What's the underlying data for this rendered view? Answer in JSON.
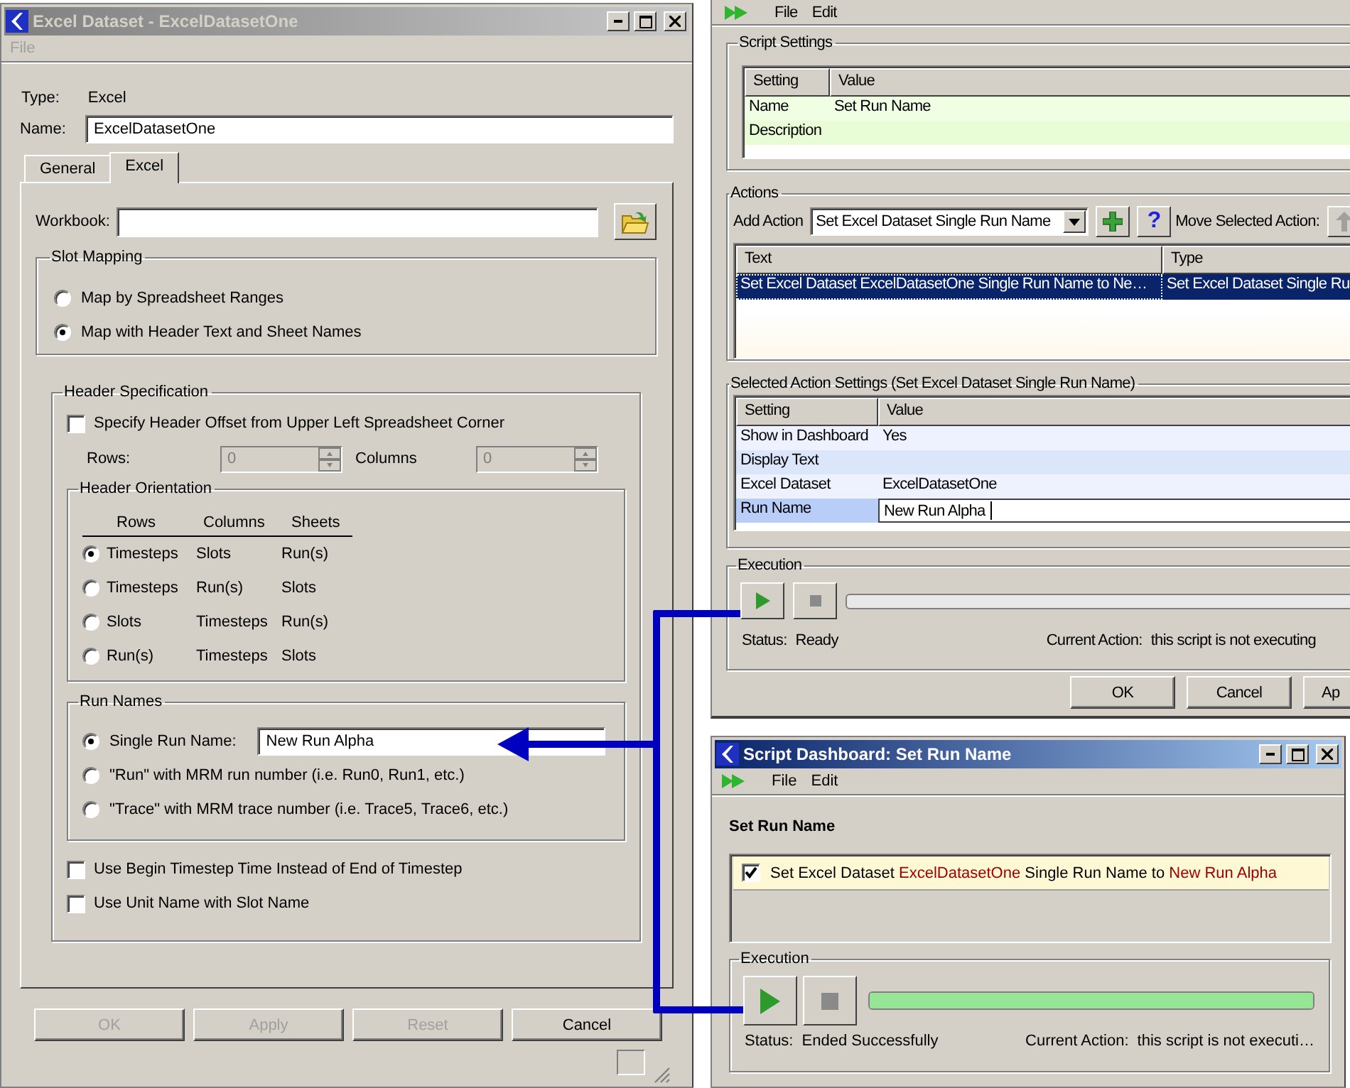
{
  "dataset_window": {
    "title": "Excel Dataset - ExcelDatasetOne",
    "active": false,
    "menu": [
      {
        "label": "File",
        "disabled": true
      }
    ],
    "type_label": "Type:",
    "type_value": "Excel",
    "name_label": "Name:",
    "name_value": "ExcelDatasetOne",
    "tabs": [
      {
        "label": "General",
        "selected": false
      },
      {
        "label": "Excel",
        "selected": true
      }
    ],
    "workbook_label": "Workbook:",
    "slot_mapping": {
      "title": "Slot Mapping",
      "options": [
        {
          "label": "Map by Spreadsheet Ranges",
          "selected": false
        },
        {
          "label": "Map with Header Text and Sheet Names",
          "selected": true
        }
      ]
    },
    "header_specification": {
      "title": "Header Specification",
      "offset": {
        "label": "Specify Header Offset from Upper Left Spreadsheet Corner",
        "checked": false
      },
      "rows_label": "Rows:",
      "rows_value": "0",
      "columns_label": "Columns",
      "columns_value": "0",
      "orientation": {
        "title": "Header Orientation",
        "columns": [
          "Rows",
          "Columns",
          "Sheets"
        ],
        "options": [
          {
            "cells": [
              "Timesteps",
              "Slots",
              "Run(s)"
            ],
            "selected": true
          },
          {
            "cells": [
              "Timesteps",
              "Run(s)",
              "Slots"
            ],
            "selected": false
          },
          {
            "cells": [
              "Slots",
              "Timesteps",
              "Run(s)"
            ],
            "selected": false
          },
          {
            "cells": [
              "Run(s)",
              "Timesteps",
              "Slots"
            ],
            "selected": false
          }
        ]
      },
      "run_names": {
        "title": "Run Names",
        "options": [
          {
            "label": "Single Run Name:",
            "value": "New Run Alpha",
            "selected": true
          },
          {
            "label": "\"Run\" with MRM run number (i.e. Run0, Run1, etc.)",
            "selected": false
          },
          {
            "label": "\"Trace\" with MRM trace number (i.e. Trace5, Trace6, etc.)",
            "selected": false
          }
        ]
      },
      "options": [
        {
          "label": "Use Begin Timestep Time Instead of End of Timestep",
          "checked": false
        },
        {
          "label": "Use Unit Name with Slot Name",
          "checked": false
        }
      ]
    },
    "buttons": [
      {
        "label": "OK",
        "disabled": true
      },
      {
        "label": "Apply",
        "disabled": true
      },
      {
        "label": "Reset",
        "disabled": true
      },
      {
        "label": "Cancel",
        "disabled": false
      }
    ]
  },
  "script_window": {
    "menu": [
      "File",
      "Edit"
    ],
    "script_settings": {
      "title": "Script Settings",
      "columns": [
        "Setting",
        "Value"
      ],
      "rows": [
        {
          "cells": [
            "Name",
            "Set Run Name"
          ]
        },
        {
          "cells": [
            "Description"
          ]
        }
      ]
    },
    "actions": {
      "title": "Actions",
      "add_label": "Add Action",
      "add_value": "Set Excel Dataset Single Run Name",
      "help": "?",
      "move_label": "Move Selected Action:",
      "columns": [
        "Text",
        "Type"
      ],
      "rows": [
        {
          "cells": [
            "Set Excel Dataset ExcelDatasetOne Single Run Name to Ne…",
            "Set Excel Dataset Single Ru"
          ],
          "selected": true
        }
      ]
    },
    "selected_settings": {
      "title": "Selected Action Settings (Set Excel Dataset Single Run Name)",
      "columns": [
        "Setting",
        "Value"
      ],
      "rows": [
        {
          "cells": [
            "Show in Dashboard",
            "Yes"
          ],
          "editing": false
        },
        {
          "cells": [
            "Display Text"
          ],
          "editing": false
        },
        {
          "cells": [
            "Excel Dataset",
            "ExcelDatasetOne"
          ],
          "editing": false
        },
        {
          "cells": [
            "Run Name",
            "New Run Alpha"
          ],
          "editing": true
        }
      ]
    },
    "execution": {
      "title": "Execution",
      "level": 0,
      "status_label": "Status:",
      "status": "Ready",
      "action_label": "Current Action:",
      "action": "this script is not executing"
    },
    "buttons": [
      "OK",
      "Cancel",
      "Ap"
    ]
  },
  "dashboard": {
    "title": "Script Dashboard: Set Run Name",
    "active": true,
    "menu": [
      "File",
      "Edit"
    ],
    "heading": "Set Run Name",
    "actions": [
      {
        "checked": true,
        "parts": [
          {
            "text": "Set Excel Dataset ",
            "highlight": false
          },
          {
            "text": "ExcelDatasetOne",
            "highlight": true
          },
          {
            "text": " Single Run Name to ",
            "highlight": false
          },
          {
            "text": "New Run Alpha",
            "highlight": true
          }
        ]
      }
    ],
    "execution": {
      "title": "Execution",
      "level": 1,
      "status_label": "Status:",
      "status": "Ended Successfully",
      "action_label": "Current Action:",
      "action": "this script is not executi…"
    }
  }
}
